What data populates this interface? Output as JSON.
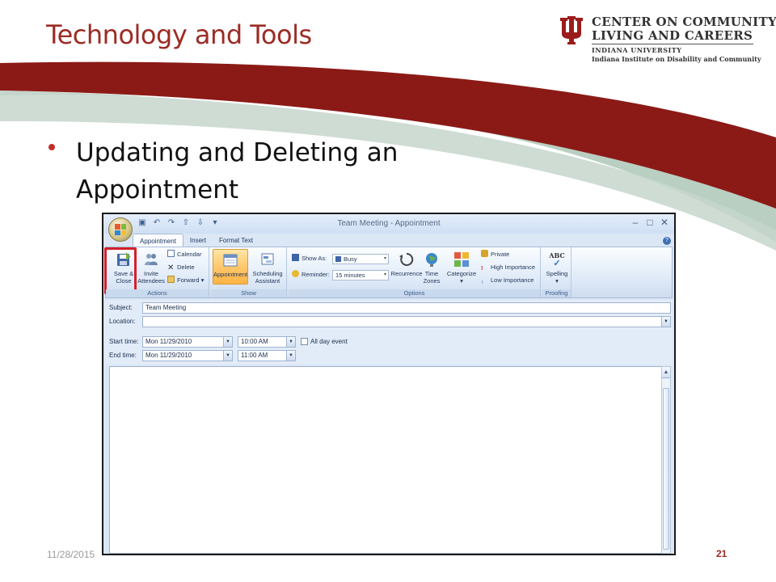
{
  "slide": {
    "title": "Technology and Tools",
    "bullet": "Updating and Deleting an Appointment",
    "footer_date": "11/28/2015",
    "page_number": "21",
    "colors": {
      "accent": "#9c2b24",
      "band_red": "#8b1a16",
      "band_sage": "#b9cfc2"
    }
  },
  "logo": {
    "line1": "CENTER ON COMMUNITY",
    "line2": "LIVING AND CAREERS",
    "line3": "INDIANA UNIVERSITY",
    "line4": "Indiana Institute on Disability and Community"
  },
  "window": {
    "title": "Team Meeting - Appointment",
    "controls": {
      "minimize": "–",
      "maximize": "□",
      "close": "✕"
    },
    "tabs": [
      {
        "label": "Appointment",
        "active": true
      },
      {
        "label": "Insert",
        "active": false
      },
      {
        "label": "Format Text",
        "active": false
      }
    ],
    "groups": {
      "actions": {
        "label": "Actions",
        "save_close": "Save & Close",
        "invite": "Invite Attendees",
        "calendar": "Calendar",
        "delete": "Delete",
        "forward": "Forward"
      },
      "show": {
        "label": "Show",
        "appointment": "Appointment",
        "scheduling": "Scheduling Assistant"
      },
      "options": {
        "label": "Options",
        "show_as_label": "Show As:",
        "show_as_value": "Busy",
        "reminder_label": "Reminder:",
        "reminder_value": "15 minutes",
        "recurrence": "Recurrence",
        "time_zones": "Time Zones",
        "categorize": "Categorize",
        "private": "Private",
        "high_importance": "High Importance",
        "low_importance": "Low Importance"
      },
      "proofing": {
        "label": "Proofing",
        "spelling": "Spelling",
        "abc": "ABC"
      }
    },
    "form": {
      "subject_label": "Subject:",
      "subject_value": "Team Meeting",
      "location_label": "Location:",
      "location_value": "",
      "start_label": "Start time:",
      "start_date": "Mon 11/29/2010",
      "start_time": "10:00 AM",
      "all_day_label": "All day event",
      "end_label": "End time:",
      "end_date": "Mon 11/29/2010",
      "end_time": "11:00 AM"
    }
  }
}
